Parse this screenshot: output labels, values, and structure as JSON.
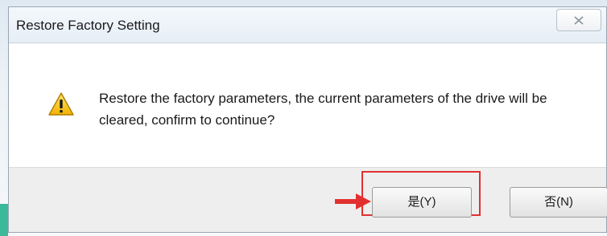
{
  "dialog": {
    "title": "Restore Factory Setting",
    "message": "Restore the factory parameters, the current parameters of the drive will be cleared, confirm to continue?",
    "close_icon": "close-x-icon",
    "warning_icon": "warning-triangle-icon"
  },
  "buttons": {
    "yes_label": "是(Y)",
    "no_label": "否(N)"
  },
  "annotation": {
    "arrow_color": "#e23030",
    "highlight_color": "#e23030"
  }
}
